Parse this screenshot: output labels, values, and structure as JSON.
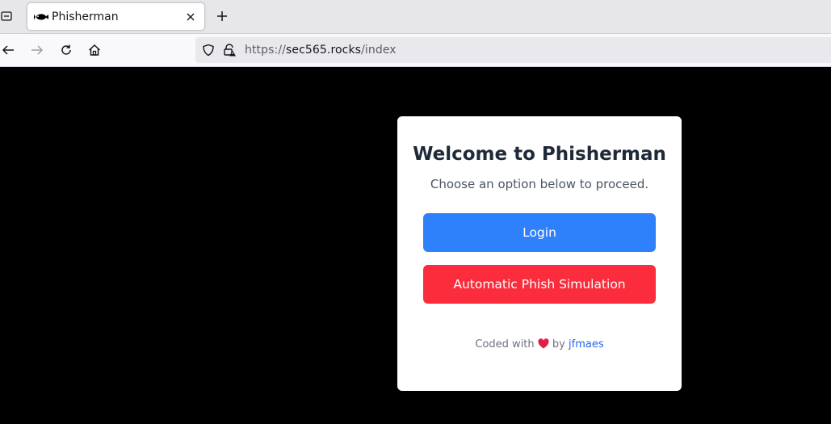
{
  "browser": {
    "tab": {
      "title": "Phisherman",
      "favicon": "fish-icon"
    },
    "address": {
      "scheme": "https://",
      "host": "sec565.rocks",
      "path": "/index"
    }
  },
  "card": {
    "heading": "Welcome to Phisherman",
    "subtitle": "Choose an option below to proceed.",
    "login_label": "Login",
    "phish_label": "Automatic Phish Simulation",
    "footer": {
      "prefix": "Coded with",
      "by": "by",
      "author": "jfmaes"
    }
  },
  "colors": {
    "login_button": "#2f80fb",
    "phish_button": "#fb2d3c",
    "author_link": "#2563eb",
    "heart": "#e11d48"
  }
}
